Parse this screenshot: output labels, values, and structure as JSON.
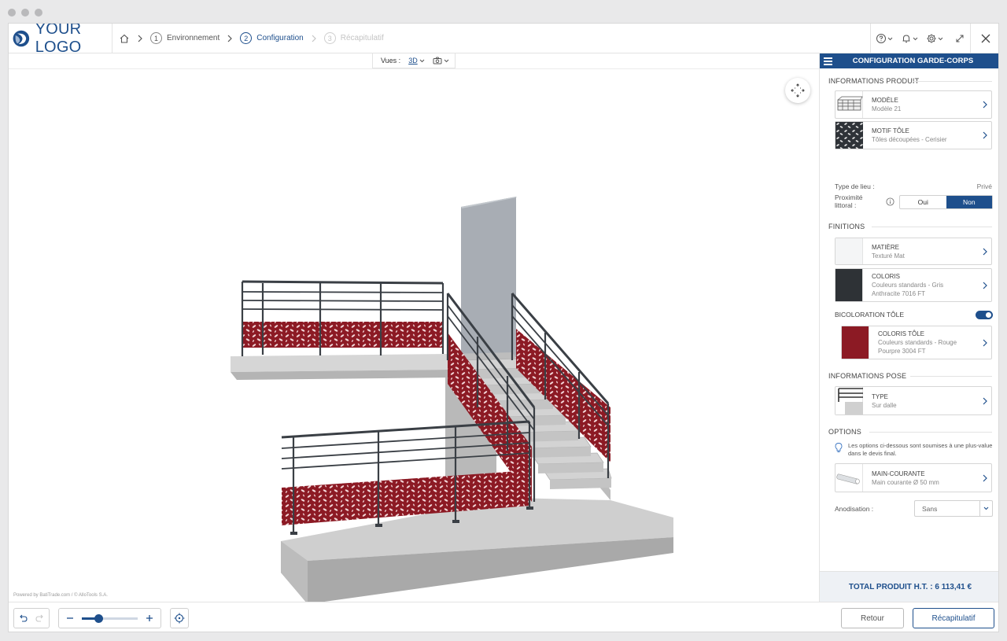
{
  "header": {
    "logo_text": "YOUR LOGO",
    "steps": [
      {
        "num": "1",
        "label": "Environnement",
        "state": "done"
      },
      {
        "num": "2",
        "label": "Configuration",
        "state": "active"
      },
      {
        "num": "3",
        "label": "Récapitulatif",
        "state": "disabled"
      }
    ],
    "tool_icons": [
      "help-icon",
      "bell-icon",
      "gear-icon",
      "expand-icon"
    ],
    "close_icon": "close-icon"
  },
  "viewer": {
    "views_label": "Vues :",
    "view_mode": "3D",
    "powered_by": "Powered by BatiTrade.com / © AlloTools S.A."
  },
  "bottom": {
    "retour_label": "Retour",
    "recap_label": "Récapitulatif",
    "zoom_level": 0.3
  },
  "sidebar": {
    "title": "CONFIGURATION GARDE-CORPS",
    "produit": {
      "title": "INFORMATIONS PRODUIT",
      "modele_k": "MODÈLE",
      "modele_v": "Modèle 21",
      "motif_k": "MOTIF TÔLE",
      "motif_v": "Tôles découpées - Cerisier",
      "type_lieu_label": "Type de lieu :",
      "type_lieu_value": "Privé",
      "proximite_label_1": "Proximité",
      "proximite_label_2": "littoral :",
      "oui": "Oui",
      "non": "Non"
    },
    "finitions": {
      "title": "FINITIONS",
      "matiere_k": "MATIÈRE",
      "matiere_v": "Texturé Mat",
      "coloris_k": "COLORIS",
      "coloris_v1": "Couleurs standards - Gris",
      "coloris_v2": "Anthracite 7016 FT",
      "bicolor_label": "BICOLORATION TÔLE",
      "coloris_tole_k": "COLORIS TÔLE",
      "coloris_tole_v1": "Couleurs standards - Rouge",
      "coloris_tole_v2": "Pourpre 3004 FT"
    },
    "pose": {
      "title": "INFORMATIONS POSE",
      "type_k": "TYPE",
      "type_v": "Sur dalle"
    },
    "options": {
      "title": "OPTIONS",
      "note": "Les options ci-dessous sont soumises à une plus-value dans le devis final.",
      "main_k": "MAIN-COURANTE",
      "main_v": "Main courante Ø 50 mm",
      "anodisation_label": "Anodisation :",
      "anodisation_value": "Sans"
    },
    "total": "TOTAL PRODUIT H.T. : 6 113,41 €"
  },
  "colors": {
    "brand": "#1e4f8c",
    "anthracite": "#2e3236",
    "pourpre": "#8c1a24",
    "concrete": "#c9c9c9"
  }
}
